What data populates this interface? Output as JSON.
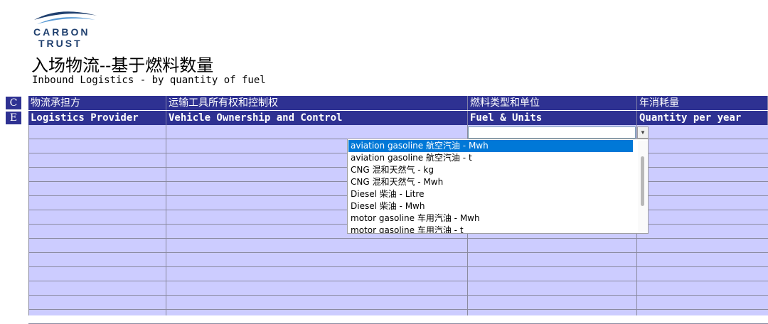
{
  "logo": {
    "line1": "CARBON",
    "line2": "TRUST"
  },
  "title_cn": "入场物流--基于燃料数量",
  "title_en": "Inbound Logistics - by quantity of fuel",
  "row_labels": {
    "cn": "C",
    "en": "E"
  },
  "headers_cn": [
    "物流承担方",
    "运输工具所有权和控制权",
    "燃料类型和单位",
    "年消耗量"
  ],
  "headers_en": [
    "Logistics Provider",
    "Vehicle Ownership and Control",
    "Fuel & Units",
    "Quantity per year"
  ],
  "dropdown": {
    "selected_index": 0,
    "options": [
      "aviation gasoline 航空汽油 - Mwh",
      "aviation gasoline 航空汽油 - t",
      "CNG 混和天然气 - kg",
      "CNG 混和天然气 - Mwh",
      "Diesel 柴油 - Litre",
      "Diesel 柴油 - Mwh",
      "motor gasoline 车用汽油 - Mwh",
      "motor gasoline 车用汽油 - t"
    ]
  },
  "colors": {
    "header_bg": "#2e3192",
    "cell_bg": "#ccccff",
    "selection": "#0078d7"
  }
}
